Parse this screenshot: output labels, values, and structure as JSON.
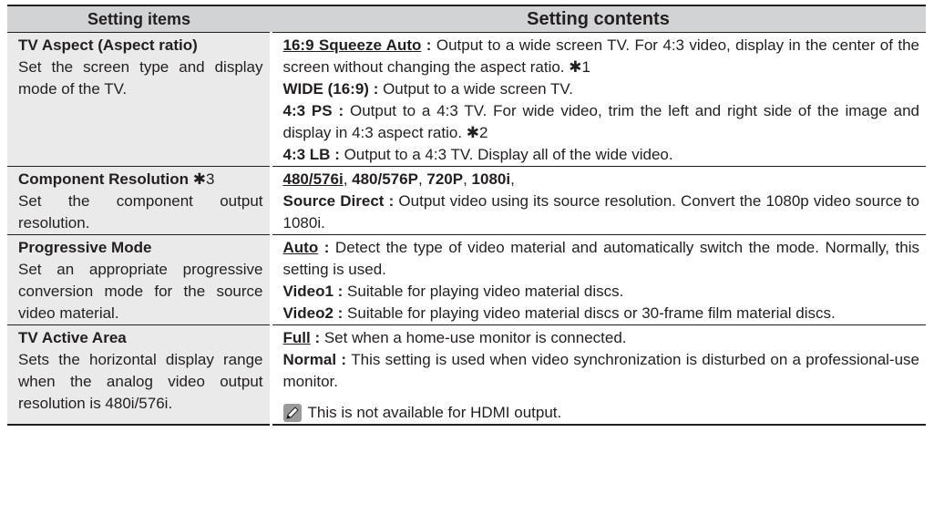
{
  "header": {
    "col1": "Setting items",
    "col2": "Setting contents"
  },
  "rows": [
    {
      "name": "TV Aspect (Aspect ratio)",
      "desc": "Set the screen type and display mode of the TV.",
      "options": [
        {
          "label": "16:9 Squeeze Auto",
          "sep": " : ",
          "text": "Output to a wide screen TV. For 4:3 video, display in the center of the screen without changing the aspect ratio. ✱1"
        },
        {
          "label": "WIDE (16:9)",
          "sep": " : ",
          "text": "Output to a wide screen TV."
        },
        {
          "label": "4:3 PS",
          "sep": " : ",
          "text": "Output to a 4:3 TV. For wide video, trim the left and right side of the image and display in 4:3 aspect ratio. ✱2"
        },
        {
          "label": "4:3 LB",
          "sep": " : ",
          "text": "Output to a 4:3 TV. Display all of the wide video."
        }
      ]
    },
    {
      "name": "Component Resolution",
      "name_note": " ✱3",
      "desc": "Set the component output resolution.",
      "res_values": [
        "480/576i",
        "480/576P",
        "720P",
        "1080i"
      ],
      "options": [
        {
          "label": "Source Direct",
          "sep": " : ",
          "text": "Output video using its source resolution. Convert the 1080p video source to 1080i."
        }
      ]
    },
    {
      "name": "Progressive Mode",
      "desc": "Set an appropriate progressive conversion mode for the source video material.",
      "options": [
        {
          "label": "Auto",
          "sep": " : ",
          "text": "Detect the type of video material and automatically switch the mode. Normally, this setting is used."
        },
        {
          "label": "Video1",
          "sep": " : ",
          "text": "Suitable for playing video material discs."
        },
        {
          "label": "Video2",
          "sep": " : ",
          "text": "Suitable for playing video material discs or 30-frame film material discs."
        }
      ]
    },
    {
      "name": "TV Active Area",
      "desc": "Sets the horizontal display range when the analog video output resolution is 480i/576i.",
      "options": [
        {
          "label": "Full",
          "sep": " : ",
          "text": "Set when a home-use monitor is connected."
        },
        {
          "label": "Normal",
          "sep": " : ",
          "text": "This setting is used when video synchronization is disturbed on a professional-use monitor."
        }
      ],
      "note": "This is not available for HDMI output."
    }
  ]
}
